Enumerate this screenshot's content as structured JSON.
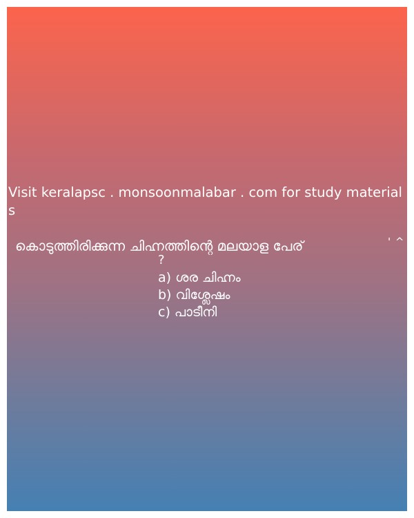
{
  "site_line": "Visit keralapsc . monsoonmalabar . com for study materials",
  "question": {
    "text": "കൊടുത്തിരിക്കുന്ന ചിഹ്നത്തിന്റെ മലയാള പേര്",
    "symbol": "' ^ '",
    "question_mark": "?"
  },
  "options": [
    "a) ശര ചിഹ്നം",
    "b) വിശ്ലേഷം",
    "c) പാടീനി"
  ],
  "colors": {
    "gradient_top": "#fc644c",
    "gradient_bottom": "#4580b3",
    "text": "#ffffff"
  }
}
